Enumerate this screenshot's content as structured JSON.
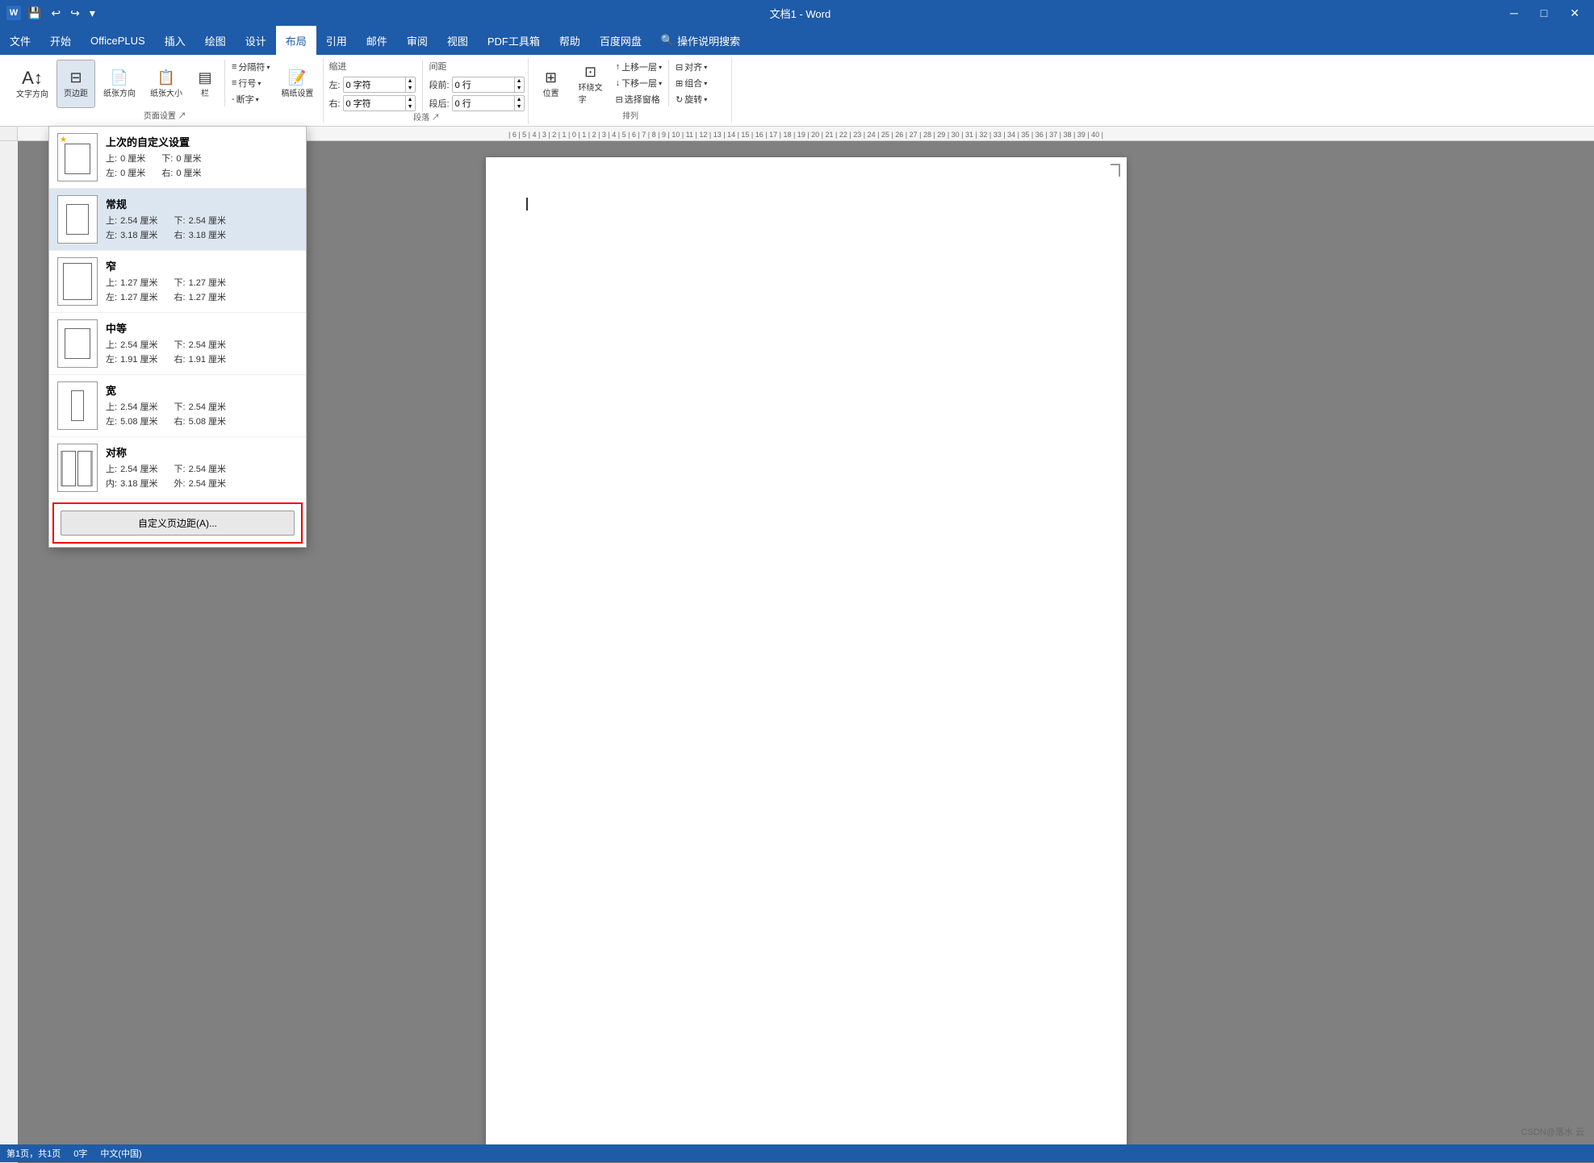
{
  "titleBar": {
    "title": "文档1 - Word",
    "appName": "Word",
    "fileName": "文档1",
    "quickAccess": [
      "保存",
      "撤销",
      "重做",
      "自定义"
    ],
    "windowControls": [
      "最小化",
      "最大化",
      "关闭"
    ]
  },
  "menuBar": {
    "items": [
      "文件",
      "开始",
      "OfficePLUS",
      "插入",
      "绘图",
      "设计",
      "布局",
      "引用",
      "邮件",
      "审阅",
      "视图",
      "PDF工具箱",
      "帮助",
      "百度网盘",
      "操作说明搜索"
    ],
    "activeItem": "布局"
  },
  "ribbon": {
    "pageSetupGroup": {
      "label": "页面设置",
      "buttons": {
        "margins": "页边距",
        "orientation": "纸张方向",
        "size": "纸张大小",
        "columns": "栏",
        "breaks": "分隔符",
        "lineNumbers": "行号",
        "hyphenation": "断字"
      },
      "draftSetup": "稿纸设置"
    },
    "indentGroup": {
      "label": "缩进",
      "leftLabel": "左:",
      "leftValue": "0 字符",
      "rightLabel": "右:",
      "rightValue": "0 字符"
    },
    "spacingGroup": {
      "label": "间距",
      "beforeLabel": "段前:",
      "beforeValue": "0 行",
      "afterLabel": "段后:",
      "afterValue": "0 行"
    },
    "paragraphGroup": {
      "label": "段落",
      "expandIcon": "↗"
    },
    "positionGroup": {
      "label": "排列",
      "buttons": {
        "position": "位置",
        "wrapText": "环绕文字",
        "bringForward": "上移一层",
        "sendBackward": "下移一层",
        "selectionPane": "选择窗格",
        "align": "对齐",
        "group": "组合",
        "rotate": "旋转"
      }
    }
  },
  "marginsDropdown": {
    "title": "页边距",
    "items": [
      {
        "id": "last-custom",
        "name": "上次的自定义设置",
        "isSelected": false,
        "hasStar": true,
        "top": "0 厘米",
        "bottom": "0 厘米",
        "left": "0 厘米",
        "right": "0 厘米"
      },
      {
        "id": "normal",
        "name": "常规",
        "isSelected": true,
        "hasStar": false,
        "top": "2.54 厘米",
        "bottom": "2.54 厘米",
        "left": "3.18 厘米",
        "right": "3.18 厘米"
      },
      {
        "id": "narrow",
        "name": "窄",
        "isSelected": false,
        "hasStar": false,
        "top": "1.27 厘米",
        "bottom": "1.27 厘米",
        "left": "1.27 厘米",
        "right": "1.27 厘米"
      },
      {
        "id": "moderate",
        "name": "中等",
        "isSelected": false,
        "hasStar": false,
        "top": "2.54 厘米",
        "bottom": "2.54 厘米",
        "left": "1.91 厘米",
        "right": "1.91 厘米"
      },
      {
        "id": "wide",
        "name": "宽",
        "isSelected": false,
        "hasStar": false,
        "top": "2.54 厘米",
        "bottom": "2.54 厘米",
        "left": "5.08 厘米",
        "right": "5.08 厘米"
      },
      {
        "id": "mirrored",
        "name": "对称",
        "isSelected": false,
        "hasStar": false,
        "top": "2.54 厘米",
        "bottom": "2.54 厘米",
        "inner": "3.18 厘米",
        "outer": "2.54 厘米",
        "isMirrored": true
      }
    ],
    "customButton": "自定义页边距(A)..."
  },
  "statusBar": {
    "page": "第1页，共1页",
    "words": "0字",
    "language": "中文(中国)"
  },
  "watermark": "CSDN@落水 云"
}
